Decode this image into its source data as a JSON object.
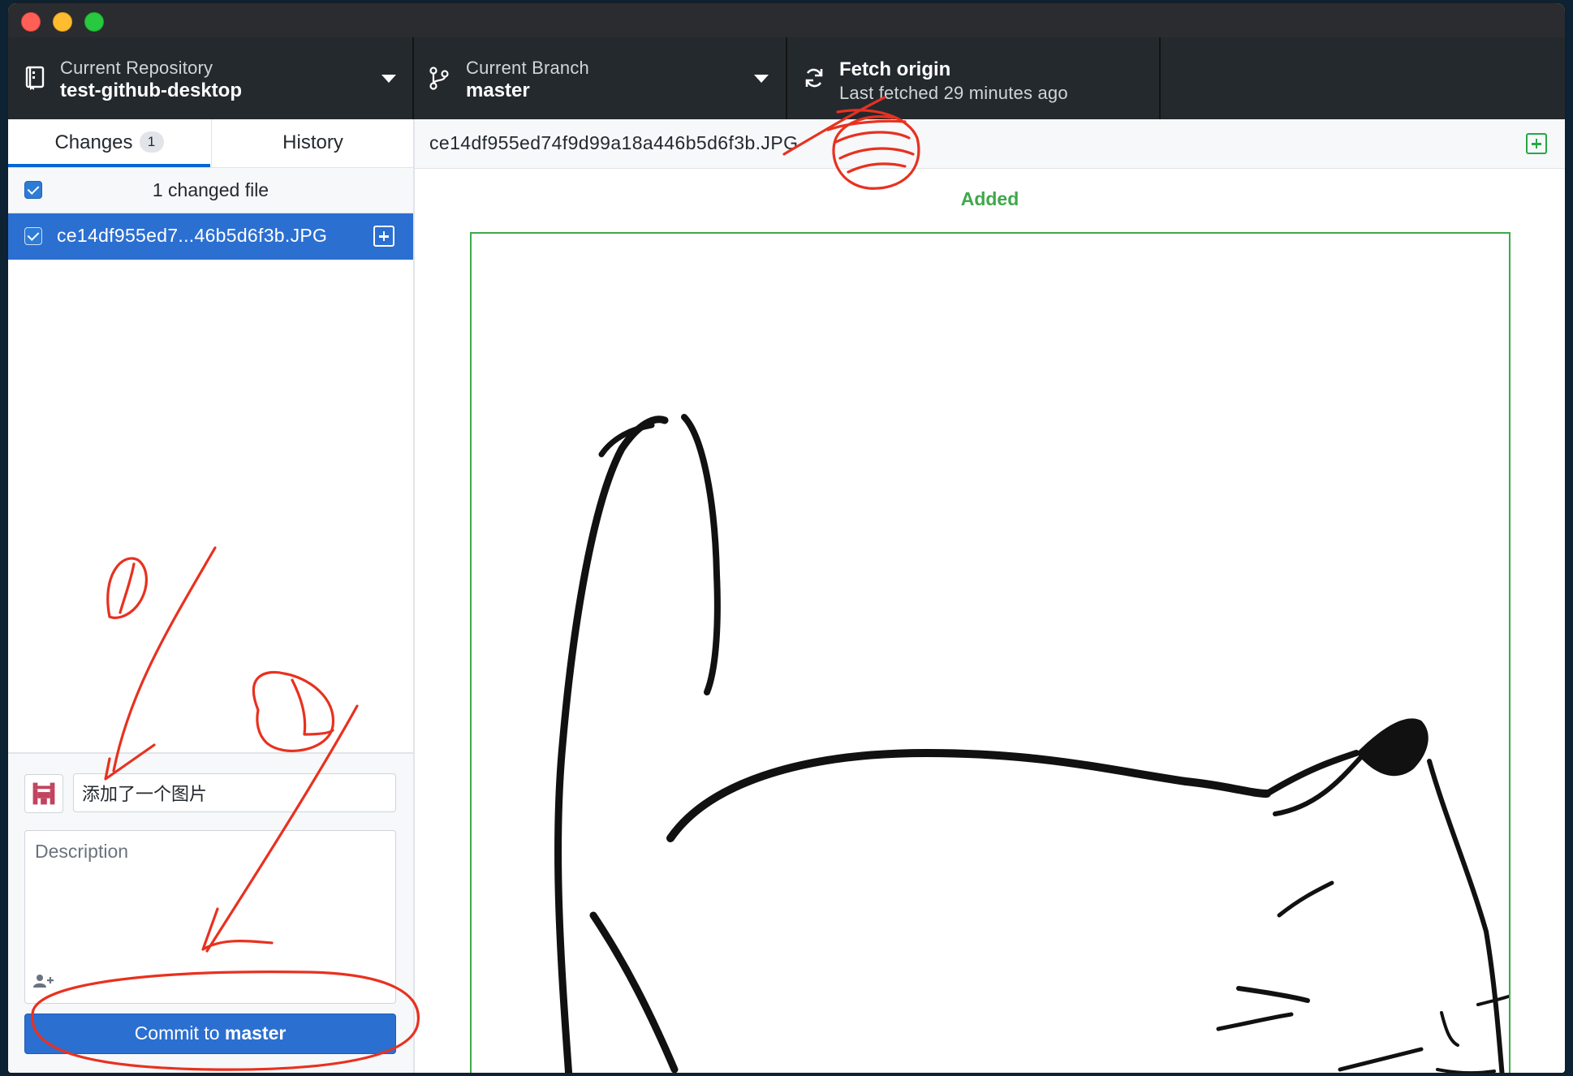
{
  "window": {
    "traffic_lights": [
      "close",
      "minimize",
      "zoom"
    ]
  },
  "toolbar": {
    "repository": {
      "label": "Current Repository",
      "value": "test-github-desktop",
      "icon": "repo-icon"
    },
    "branch": {
      "label": "Current Branch",
      "value": "master",
      "icon": "branch-icon"
    },
    "fetch": {
      "label": "Fetch origin",
      "status": "Last fetched 29 minutes ago",
      "icon": "sync-icon"
    }
  },
  "sidebar": {
    "tabs": [
      {
        "label": "Changes",
        "count": "1"
      },
      {
        "label": "History"
      }
    ],
    "changed_files_header": "1 changed file",
    "files": [
      {
        "name": "ce14df955ed7...46b5d6f3b.JPG",
        "status": "added"
      }
    ],
    "commit": {
      "summary_value": "添加了一个图片",
      "description_placeholder": "Description",
      "button_prefix": "Commit to",
      "button_branch": "master"
    }
  },
  "diff": {
    "path": "ce14df955ed74f9d99a18a446b5d6f3b.JPG",
    "status_label": "Added"
  },
  "annotations": {
    "marks": [
      "①",
      "①"
    ],
    "color": "#e8311f"
  },
  "colors": {
    "toolbar_bg": "#24292e",
    "accent_blue": "#2b6fd1",
    "added_green": "#3fa84a"
  }
}
